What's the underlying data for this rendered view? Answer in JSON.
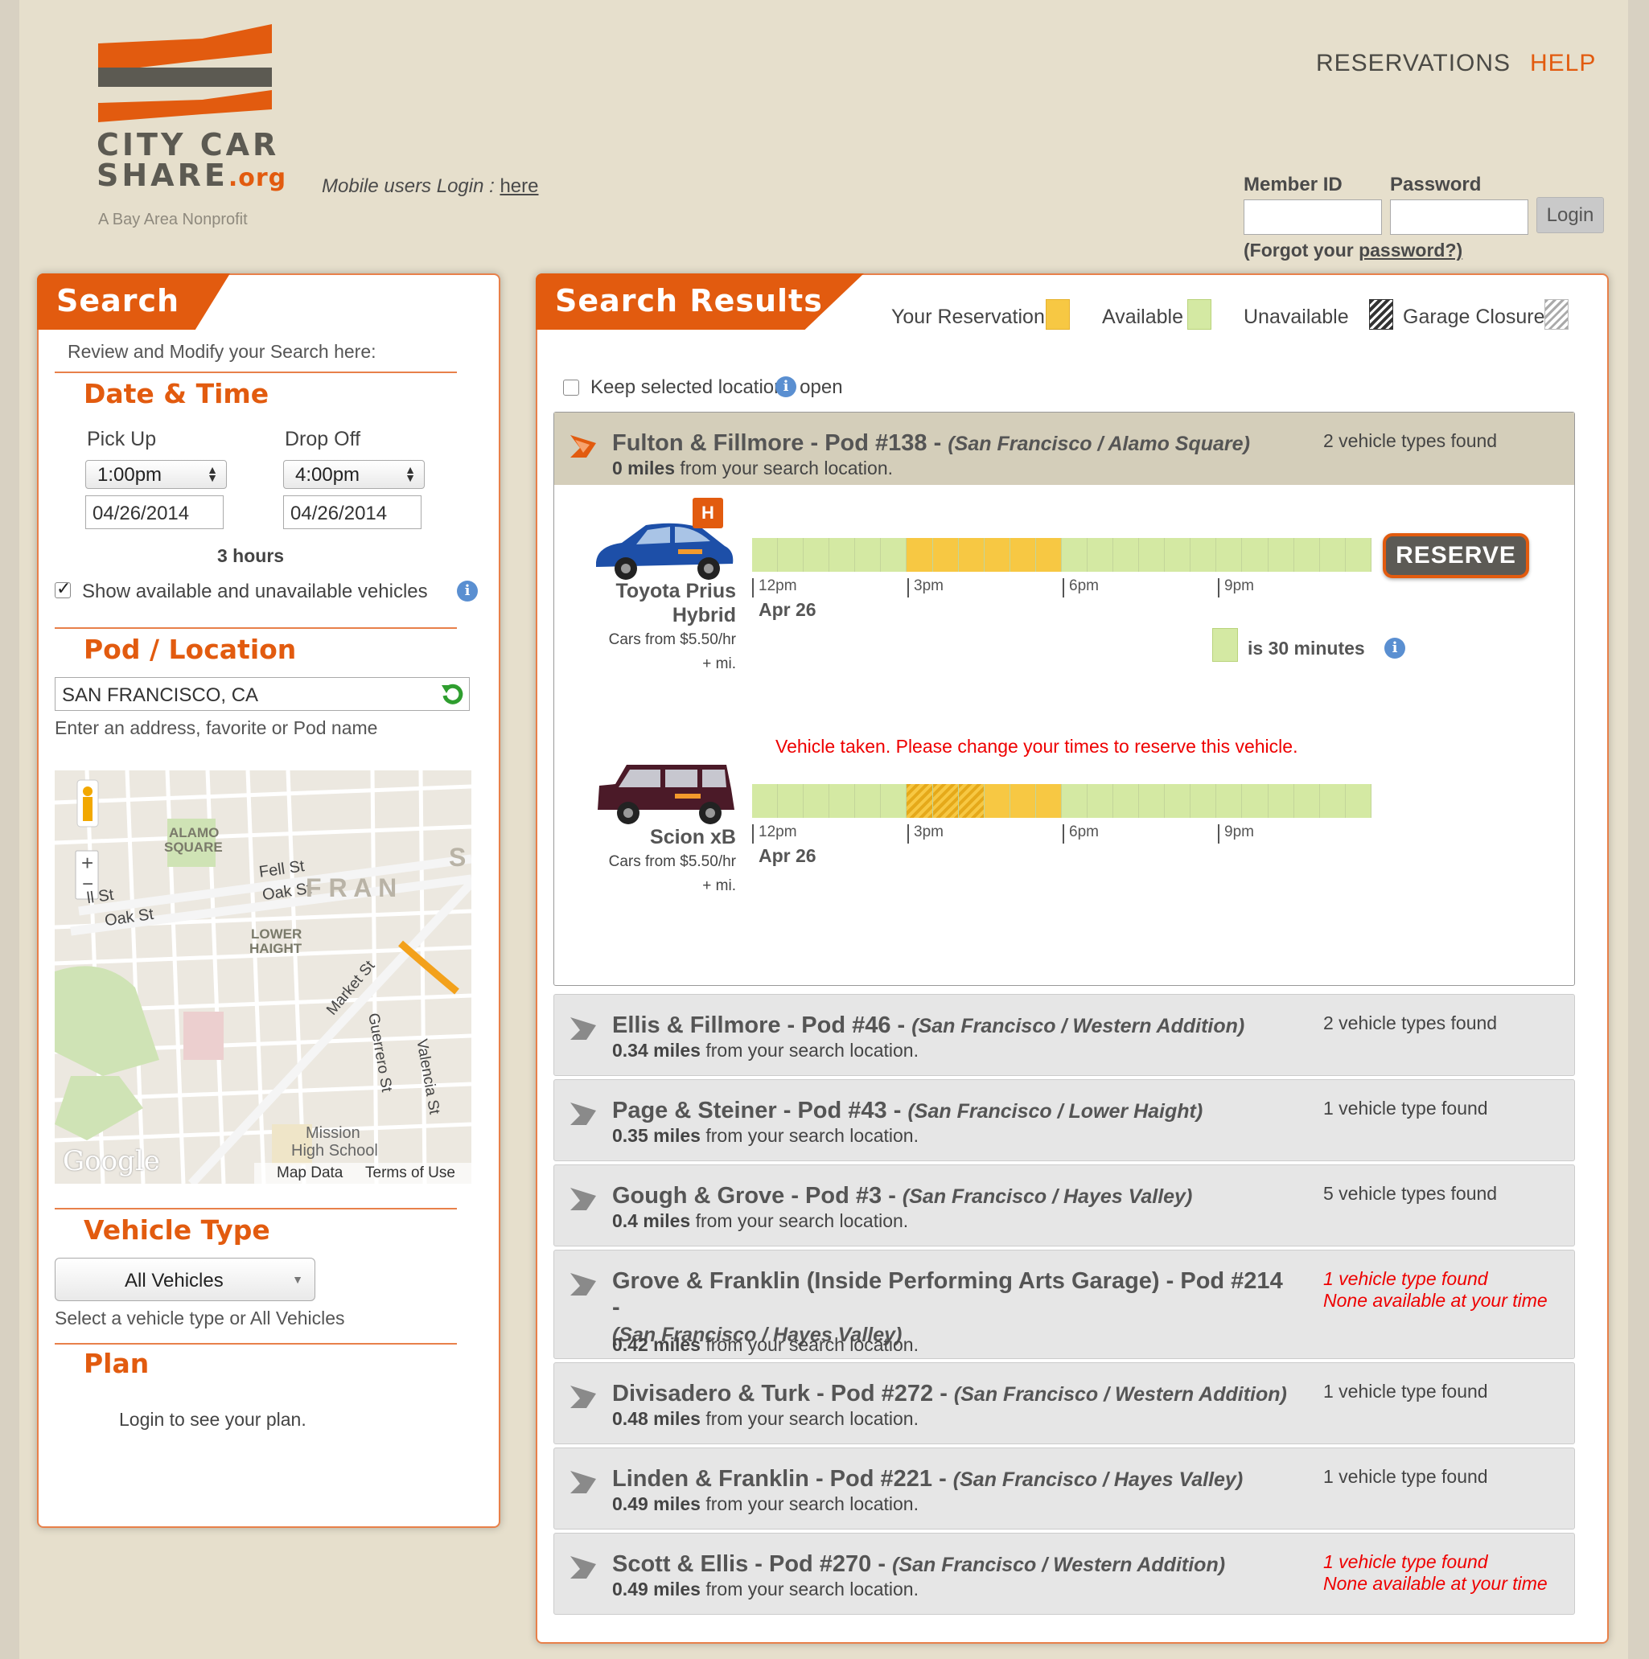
{
  "header": {
    "logo_line1": "CITY CAR",
    "logo_line2": "SHARE",
    "logo_org": ".org",
    "logo_sub": "A Bay Area Nonprofit",
    "mobile_text": "Mobile users Login : ",
    "mobile_link": "here",
    "nav": [
      {
        "label": "RESERVATIONS"
      },
      {
        "label": "HELP"
      }
    ],
    "member_id_label": "Member ID",
    "password_label": "Password",
    "login_label": "Login",
    "forgot_prefix": "(Forgot your ",
    "forgot_link": "password?)"
  },
  "search": {
    "title": "Search",
    "intro": "Review and Modify your Search here:",
    "date_time_heading": "Date & Time",
    "pickup_label": "Pick Up",
    "dropoff_label": "Drop Off",
    "pickup_time": "1:00pm",
    "dropoff_time": "4:00pm",
    "pickup_date": "04/26/2014",
    "dropoff_date": "04/26/2014",
    "duration": "3 hours",
    "show_all_label": "Show available and unavailable vehicles",
    "pod_heading": "Pod / Location",
    "location_value": "SAN FRANCISCO, CA",
    "location_hint": "Enter an address, favorite or Pod name",
    "vehicle_heading": "Vehicle Type",
    "vehicle_value": "All Vehicles",
    "vehicle_hint": "Select a vehicle type or All Vehicles",
    "plan_heading": "Plan",
    "plan_text": "Login to see your plan."
  },
  "map": {
    "labels": {
      "alamo": "ALAMO",
      "square": "SQUARE",
      "fell": "Fell St",
      "oak1": "Oak St",
      "oak2": "Oak St",
      "fell2": "ll St",
      "lower": "LOWER",
      "haight": "HAIGHT",
      "market": "Market St",
      "guerrero": "Guerrero St",
      "valencia": "Valencia St",
      "mission": "Mission",
      "high_school": "High School",
      "fran": "F R A N",
      "s": "S",
      "google": "Google",
      "map_data": "Map Data",
      "terms": "Terms of Use",
      "zoom_in": "+",
      "zoom_out": "−"
    }
  },
  "results": {
    "title": "Search Results",
    "legend": [
      {
        "label": "Your Reservation",
        "color": "#f7c843"
      },
      {
        "label": "Available",
        "color": "#d4e9a3"
      },
      {
        "label": "Unavailable",
        "color": "#333333"
      },
      {
        "label": "Garage Closure",
        "color": "#cccccc"
      }
    ],
    "keep_open_label": "Keep selected locations open",
    "open_pod": {
      "name": "Fulton & Fillmore - Pod #138 - ",
      "area": "(San Francisco / Alamo Square)",
      "dist": "0 miles",
      "dist_suffix": " from your search location.",
      "found": "2 vehicle types found",
      "vehicles": [
        {
          "name1": "Toyota Prius",
          "name2": "Hybrid",
          "price1": "Cars from $5.50/hr",
          "price2": "+ mi.",
          "badge": "H",
          "reserve": "RESERVE",
          "ticks": [
            "12pm",
            "3pm",
            "6pm",
            "9pm"
          ],
          "date": "Apr 26",
          "legend_text": "is 30 minutes"
        },
        {
          "name1": "Scion xB",
          "price1": "Cars from $5.50/hr",
          "price2": "+ mi.",
          "warning": "Vehicle taken. Please change your times to reserve this vehicle.",
          "ticks": [
            "12pm",
            "3pm",
            "6pm",
            "9pm"
          ],
          "date": "Apr 26"
        }
      ]
    },
    "pods": [
      {
        "name": "Ellis & Fillmore - Pod #46 - ",
        "area": "(San Francisco / Western Addition)",
        "dist": "0.34 miles",
        "found": "2 vehicle types found"
      },
      {
        "name": "Page & Steiner - Pod #43 - ",
        "area": "(San Francisco / Lower Haight)",
        "dist": "0.35 miles",
        "found": "1 vehicle type found"
      },
      {
        "name": "Gough & Grove - Pod #3 - ",
        "area": "(San Francisco / Hayes Valley)",
        "dist": "0.4 miles",
        "found": "5 vehicle types found"
      },
      {
        "name": "Grove & Franklin (Inside Performing Arts Garage) - Pod #214 - ",
        "area": "(San Francisco / Hayes Valley)",
        "dist": "0.42 miles",
        "found": "1 vehicle type found",
        "found2": "None available at your time"
      },
      {
        "name": "Divisadero & Turk - Pod #272 - ",
        "area": "(San Francisco / Western Addition)",
        "dist": "0.48 miles",
        "found": "1 vehicle type found"
      },
      {
        "name": "Linden & Franklin - Pod #221 - ",
        "area": "(San Francisco / Hayes Valley)",
        "dist": "0.49 miles",
        "found": "1 vehicle type found"
      },
      {
        "name": "Scott & Ellis - Pod #270 - ",
        "area": "(San Francisco / Western Addition)",
        "dist": "0.49 miles",
        "found": "1 vehicle type found",
        "found2": "None available at your time"
      }
    ],
    "dist_suffix": " from your search location."
  },
  "colors": {
    "brand_orange": "#e25b0f",
    "logo_gray": "#5c5a52",
    "available": "#d4e9a3",
    "reserved": "#f7c843",
    "warning": "#e00000"
  }
}
